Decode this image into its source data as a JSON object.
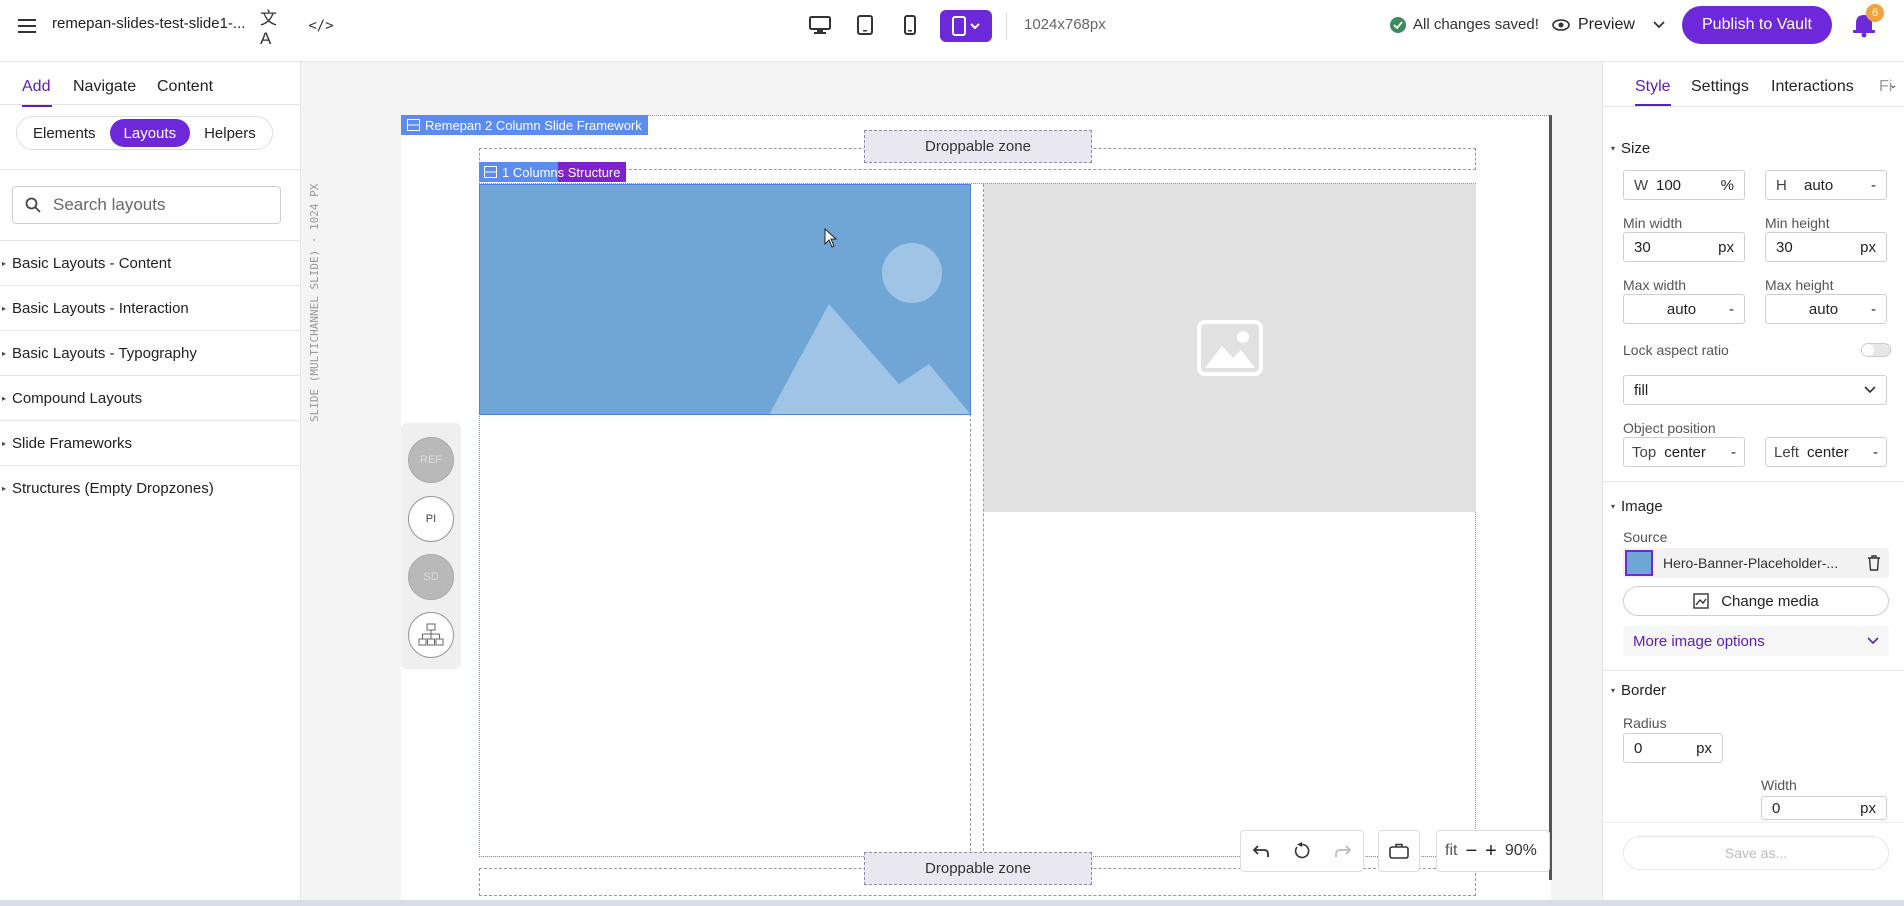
{
  "topbar": {
    "file_name": "remepan-slides-test-slide1-...",
    "size_label": "1024x768px",
    "save_status": "All changes saved!",
    "preview_label": "Preview",
    "publish_label": "Publish to Vault",
    "notification_count": "6"
  },
  "left": {
    "tabs": [
      "Add",
      "Navigate",
      "Content"
    ],
    "segments": [
      "Elements",
      "Layouts",
      "Helpers"
    ],
    "search_placeholder": "Search layouts",
    "categories": [
      "Basic Layouts - Content",
      "Basic Layouts - Interaction",
      "Basic Layouts - Typography",
      "Compound Layouts",
      "Slide Frameworks",
      "Structures (Empty Dropzones)"
    ]
  },
  "canvas": {
    "vertical_label": "SLIDE (MULTICHANNEL SLIDE) · 1024 PX",
    "framework_label": "Remepan 2 Column Slide Framework",
    "structure_label_a": "1 Column",
    "structure_label_b": "s Structure",
    "dropzone_label": "Droppable zone",
    "side_circles": [
      "REF",
      "PI",
      "SD"
    ],
    "zoom_fit": "fit",
    "zoom_level": "90%"
  },
  "right": {
    "tabs": [
      "Style",
      "Settings",
      "Interactions",
      "Fi"
    ],
    "size_section": "Size",
    "width_prefix": "W",
    "width_value": "100",
    "width_unit": "%",
    "height_prefix": "H",
    "height_value": "auto",
    "dash": "-",
    "min_width_label": "Min width",
    "min_width_value": "30",
    "min_height_label": "Min height",
    "min_height_value": "30",
    "px": "px",
    "max_width_label": "Max width",
    "max_width_value": "auto",
    "max_height_label": "Max height",
    "max_height_value": "auto",
    "lock_aspect_label": "Lock aspect ratio",
    "fit_value": "fill",
    "object_position_label": "Object position",
    "pos_top": "Top",
    "pos_top_value": "center",
    "pos_left": "Left",
    "pos_left_value": "center",
    "image_section": "Image",
    "source_label": "Source",
    "source_value": "Hero-Banner-Placeholder-...",
    "change_media": "Change media",
    "more_image_options": "More image options",
    "border_section": "Border",
    "radius_label": "Radius",
    "radius_value": "0",
    "width_label": "Width",
    "border_width_value": "0",
    "save_as": "Save as..."
  },
  "colors": {
    "accent": "#6d28d9",
    "selection": "#5b8cf0",
    "image_blue": "#6fa6d6"
  }
}
